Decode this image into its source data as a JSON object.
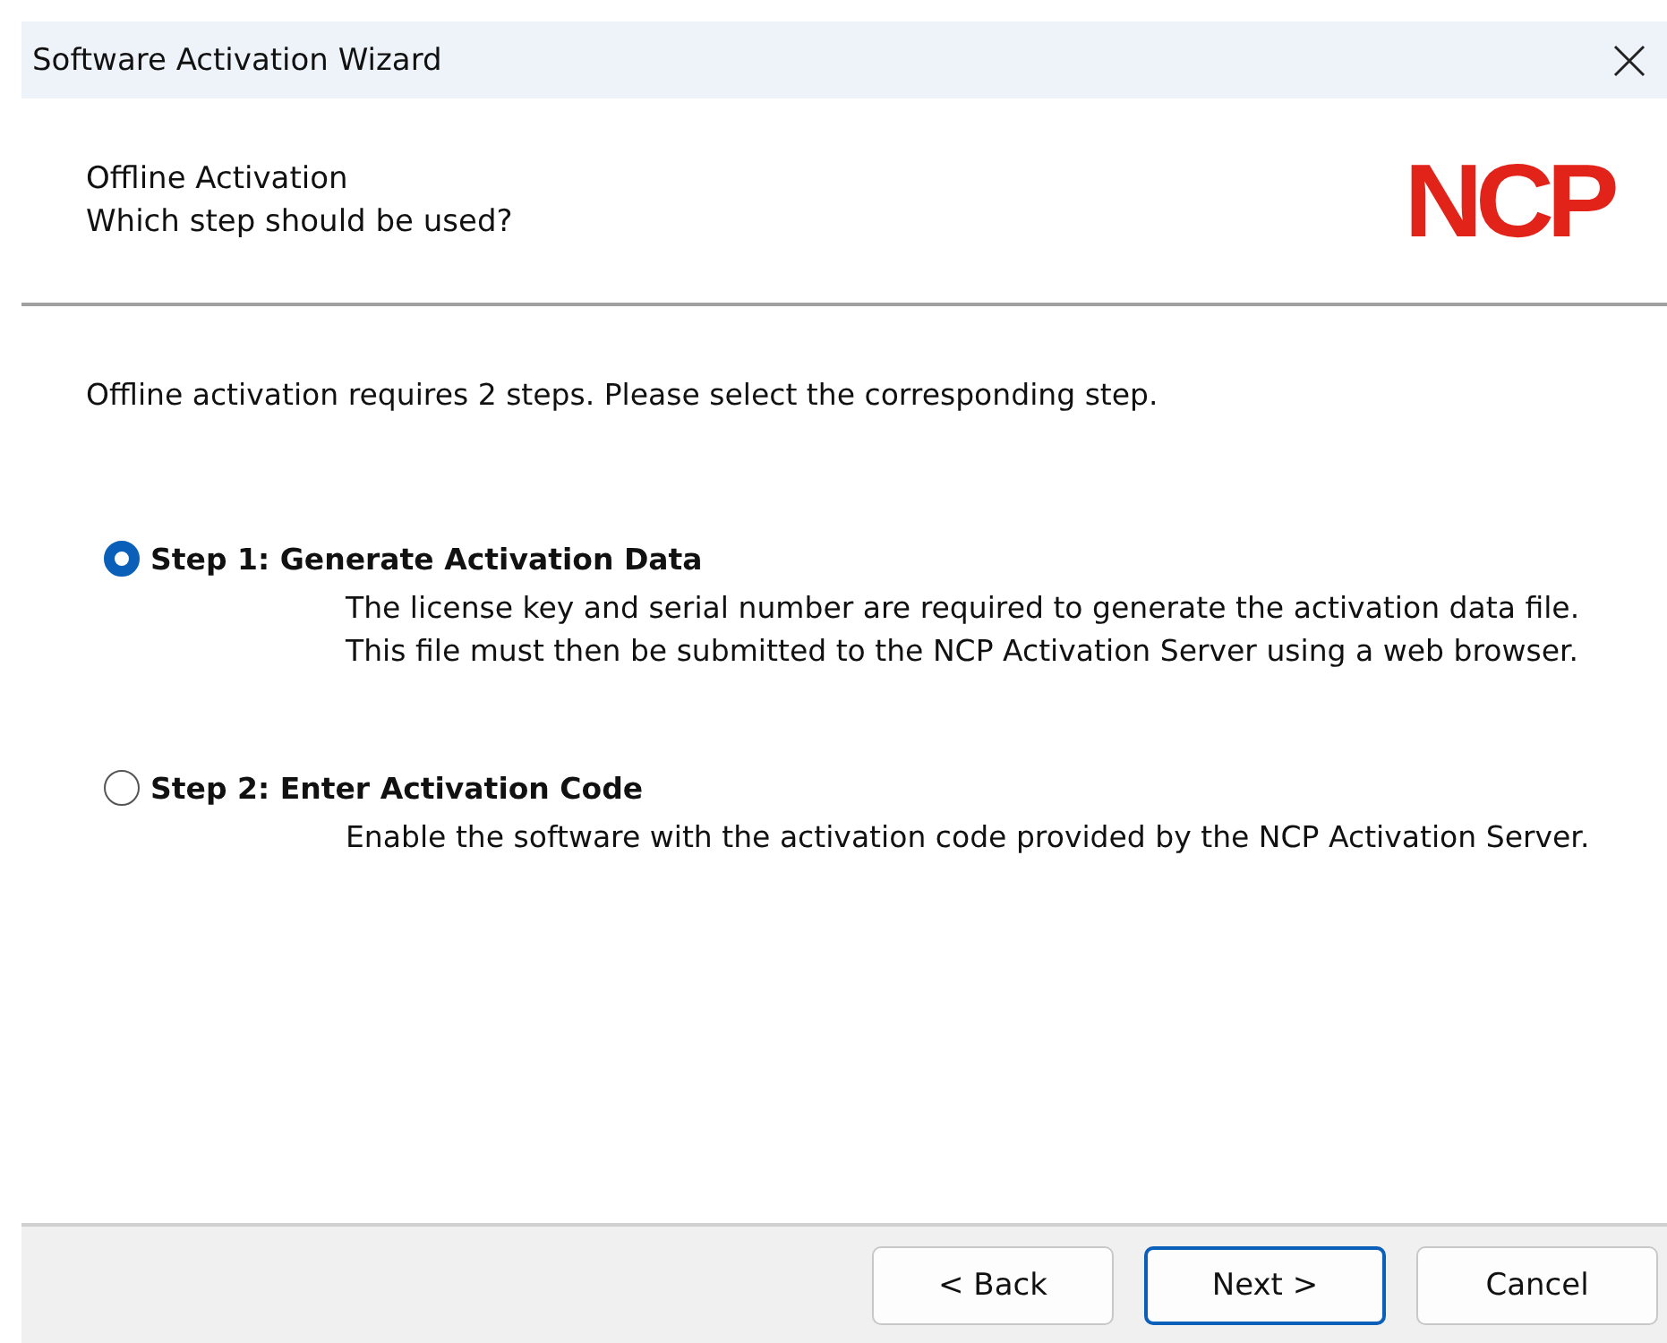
{
  "window": {
    "title": "Software Activation Wizard"
  },
  "header": {
    "title": "Offline Activation",
    "subtitle": "Which step should be used?",
    "logo": "NCP"
  },
  "intro": "Offline activation requires 2 steps. Please select the corresponding step.",
  "options": [
    {
      "label": "Step 1: Generate Activation Data",
      "selected": true,
      "description": "The license key and serial number are required to generate the activation data file. This file must then be submitted to the NCP Activation Server using a web browser."
    },
    {
      "label": "Step 2: Enter Activation Code",
      "selected": false,
      "description": "Enable the software with the activation code provided by the NCP Activation Server."
    }
  ],
  "buttons": [
    {
      "label": "< Back",
      "default": false
    },
    {
      "label": "Next >",
      "default": true
    },
    {
      "label": "Cancel",
      "default": false
    }
  ]
}
